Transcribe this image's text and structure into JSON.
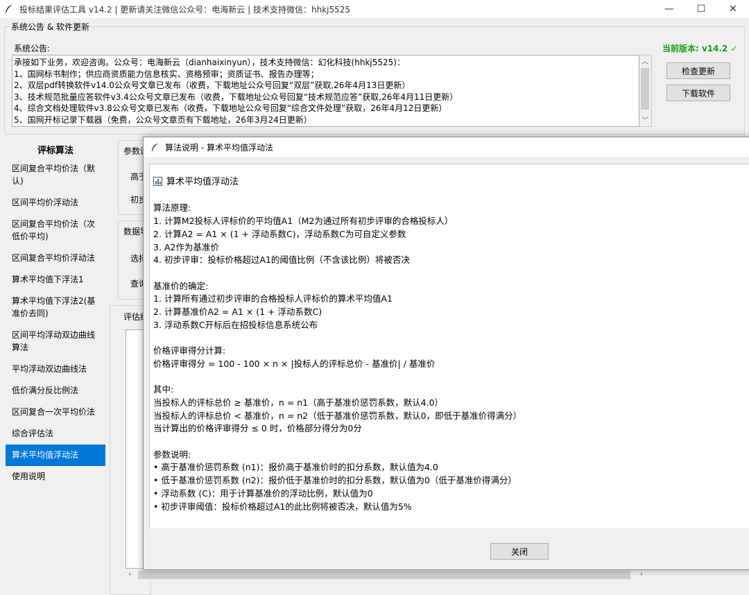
{
  "window": {
    "title": "投标结果评估工具 v14.2 | 更新请关注微信公众号：电海新云 | 技术支持微信：hhkj5525",
    "minimize": "—",
    "maximize": "☐",
    "close": "✕"
  },
  "announcement": {
    "group_title": "系统公告 & 软件更新",
    "label": "系统公告:",
    "lines": [
      "承接如下业务，欢迎咨询。公众号：电海新云（dianhaixinyun），技术支持微信：幻化科技(hhkj5525)：",
      "1、国网标书制作；供应商资质能力信息核实、资格预审；资质证书、报告办理等；",
      "2、双层pdf转换软件v14.0公众号文章已发布（收费，下载地址公众号回复“双层”获取,26年4月13日更新）",
      "3、技术规范批量应答软件v3.4公众号文章已发布（收费，下载地址公众号回复“技术规范应答”获取,26年4月11日更新）",
      "4、综合文档处理软件v3.8公众号文章已发布（收费，下载地址公众号回复“综合文件处理”获取，26年4月12日更新）",
      "5、国网开标记录下载器（免费，公众号文章页有下载地址，26年3月24日更新）"
    ],
    "version": "当前版本: v14.2 ✓",
    "check_update": "检查更新",
    "download": "下载软件"
  },
  "algorithms": {
    "title": "评标算法",
    "items": [
      "区间复合平均价法（默认)",
      "区间平均价浮动法",
      "区间复合平均价法（次低价平均)",
      "区间复合平均价浮动法",
      "算术平均值下浮法1",
      "算术平均值下浮法2(基准价去同)",
      "区间平均浮动双边曲线算法",
      "平均浮动双边曲线法",
      "低价满分反比例法",
      "区间复合一次平均价法",
      "综合评估法",
      "算术平均值浮动法",
      "使用说明"
    ],
    "active_index": 11
  },
  "background": {
    "param_label": "参数设",
    "high_label": "高于",
    "init_label": "初步",
    "data_label": "数据导",
    "select_label": "选择",
    "query_label": "查询",
    "eval_label": "评估结"
  },
  "dialog": {
    "title": "算法说明 - 算术平均值浮动法",
    "heading": "算术平均值浮动法",
    "lines": [
      "",
      "算法原理:",
      "1. 计算M2投标人评标价的平均值A1（M2为通过所有初步评审的合格投标人）",
      "2. 计算A2 = A1 × (1 + 浮动系数C)，浮动系数C为可自定义参数",
      "3. A2作为基准价",
      "4. 初步评审：投标价格超过A1的阈值比例（不含该比例）将被否决",
      "",
      "基准价的确定:",
      "1. 计算所有通过初步评审的合格投标人评标价的算术平均值A1",
      "2. 计算基准价A2 = A1 × (1 + 浮动系数C)",
      "3. 浮动系数C开标后在招投标信息系统公布",
      "",
      "价格评审得分计算:",
      "价格评审得分 = 100 - 100 × n × |投标人的评标总价 - 基准价| / 基准价",
      "",
      "其中:",
      "当投标人的评标总价 ≥ 基准价，n = n1（高于基准价惩罚系数，默认4.0）",
      "当投标人的评标总价 < 基准价，n = n2（低于基准价惩罚系数，默认0，即低于基准价得满分）",
      "当计算出的价格评审得分 ≤ 0 时，价格部分得分为0分",
      "",
      "参数说明:",
      "• 高于基准价惩罚系数 (n1)：报价高于基准价时的扣分系数，默认值为4.0",
      "• 低于基准价惩罚系数 (n2)：报价低于基准价时的扣分系数，默认值为0（低于基准价得满分）",
      "• 浮动系数 (C)：用于计算基准价的浮动比例，默认值为0",
      "• 初步评审阈值：投标价格超过A1的此比例将被否决，默认值为5%"
    ],
    "close_button": "关闭"
  },
  "colors": {
    "accent": "#0078d7",
    "version_green": "#1a9c1a"
  }
}
